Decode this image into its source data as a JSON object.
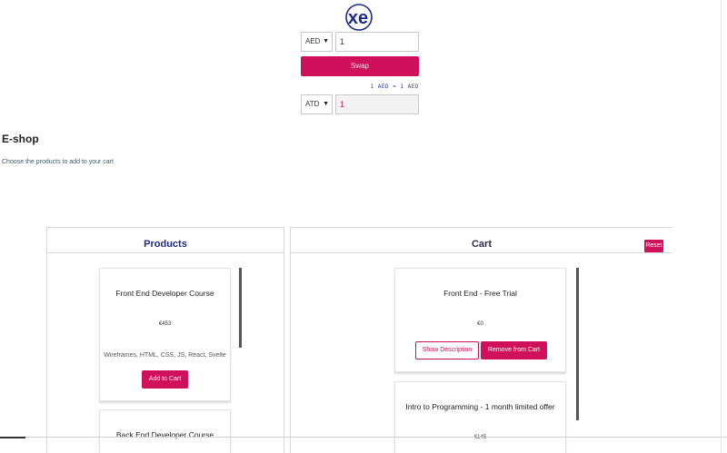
{
  "converter": {
    "logo_text": "xe",
    "from_currency": "AED",
    "from_amount": "1",
    "swap_label": "Swap",
    "rate_text": "1 AED = 1 AED",
    "to_currency": "ATD",
    "to_amount": "1",
    "accent_color": "#d0105a",
    "logo_color": "#1f2a8a"
  },
  "shop": {
    "title": "E-shop",
    "subtitle": "Choose the products to add to your cart"
  },
  "products": {
    "header": "Products",
    "items": [
      {
        "title": "Front End Developer Course",
        "price": "€453",
        "description": "Wireframes, HTML, CSS, JS, React, Svelte",
        "button": "Add to Cart"
      },
      {
        "title": "Back End Developer Course"
      }
    ]
  },
  "cart": {
    "header": "Cart",
    "reset_label": "Reset",
    "items": [
      {
        "title": "Front End - Free Trial",
        "price": "€0",
        "show_label": "Show Description",
        "remove_label": "Remove from Cart"
      },
      {
        "title": "Intro to Programming - 1 month limited offer",
        "price": "€145"
      }
    ]
  }
}
